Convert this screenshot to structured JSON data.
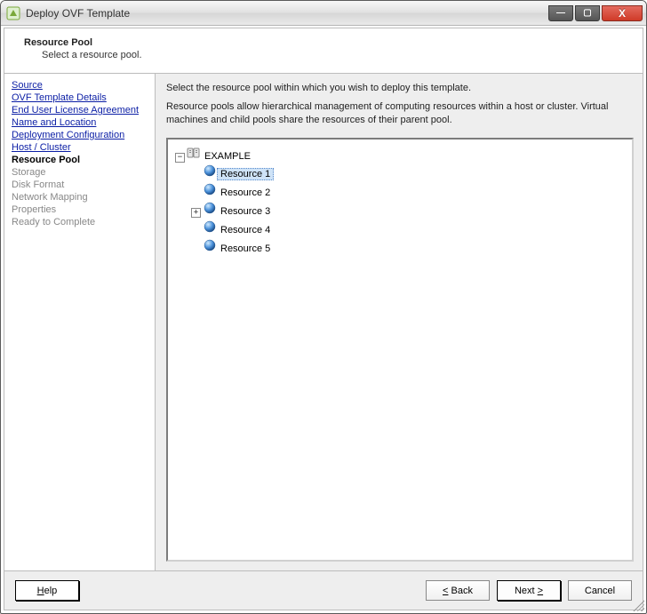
{
  "titlebar": {
    "title": "Deploy OVF Template"
  },
  "header": {
    "title": "Resource Pool",
    "subtitle": "Select a resource pool."
  },
  "sidebar": {
    "steps": [
      {
        "label": "Source",
        "state": "link"
      },
      {
        "label": "OVF Template Details",
        "state": "link"
      },
      {
        "label": "End User License Agreement",
        "state": "link"
      },
      {
        "label": "Name and Location",
        "state": "link"
      },
      {
        "label": "Deployment Configuration",
        "state": "link"
      },
      {
        "label": "Host / Cluster",
        "state": "link"
      },
      {
        "label": "Resource Pool",
        "state": "current"
      },
      {
        "label": "Storage",
        "state": "future"
      },
      {
        "label": "Disk Format",
        "state": "future"
      },
      {
        "label": "Network Mapping",
        "state": "future"
      },
      {
        "label": "Properties",
        "state": "future"
      },
      {
        "label": "Ready to Complete",
        "state": "future"
      }
    ]
  },
  "main": {
    "desc1": "Select the resource pool within which you wish to deploy this template.",
    "desc2": "Resource pools allow hierarchical management of computing resources within a host or cluster. Virtual machines and child pools share the resources of their parent pool.",
    "tree": {
      "root": {
        "label": "EXAMPLE",
        "expanded": true,
        "children": [
          {
            "label": "Resource 1",
            "selected": true,
            "expandable": false
          },
          {
            "label": "Resource 2",
            "selected": false,
            "expandable": false
          },
          {
            "label": "Resource 3",
            "selected": false,
            "expandable": true,
            "expanded": false
          },
          {
            "label": "Resource 4",
            "selected": false,
            "expandable": false
          },
          {
            "label": "Resource 5",
            "selected": false,
            "expandable": false
          }
        ]
      }
    }
  },
  "footer": {
    "help": "Help",
    "back_prefix": "<",
    "back_label": " Back",
    "next_label": "Next ",
    "next_suffix": ">",
    "cancel": "Cancel"
  }
}
